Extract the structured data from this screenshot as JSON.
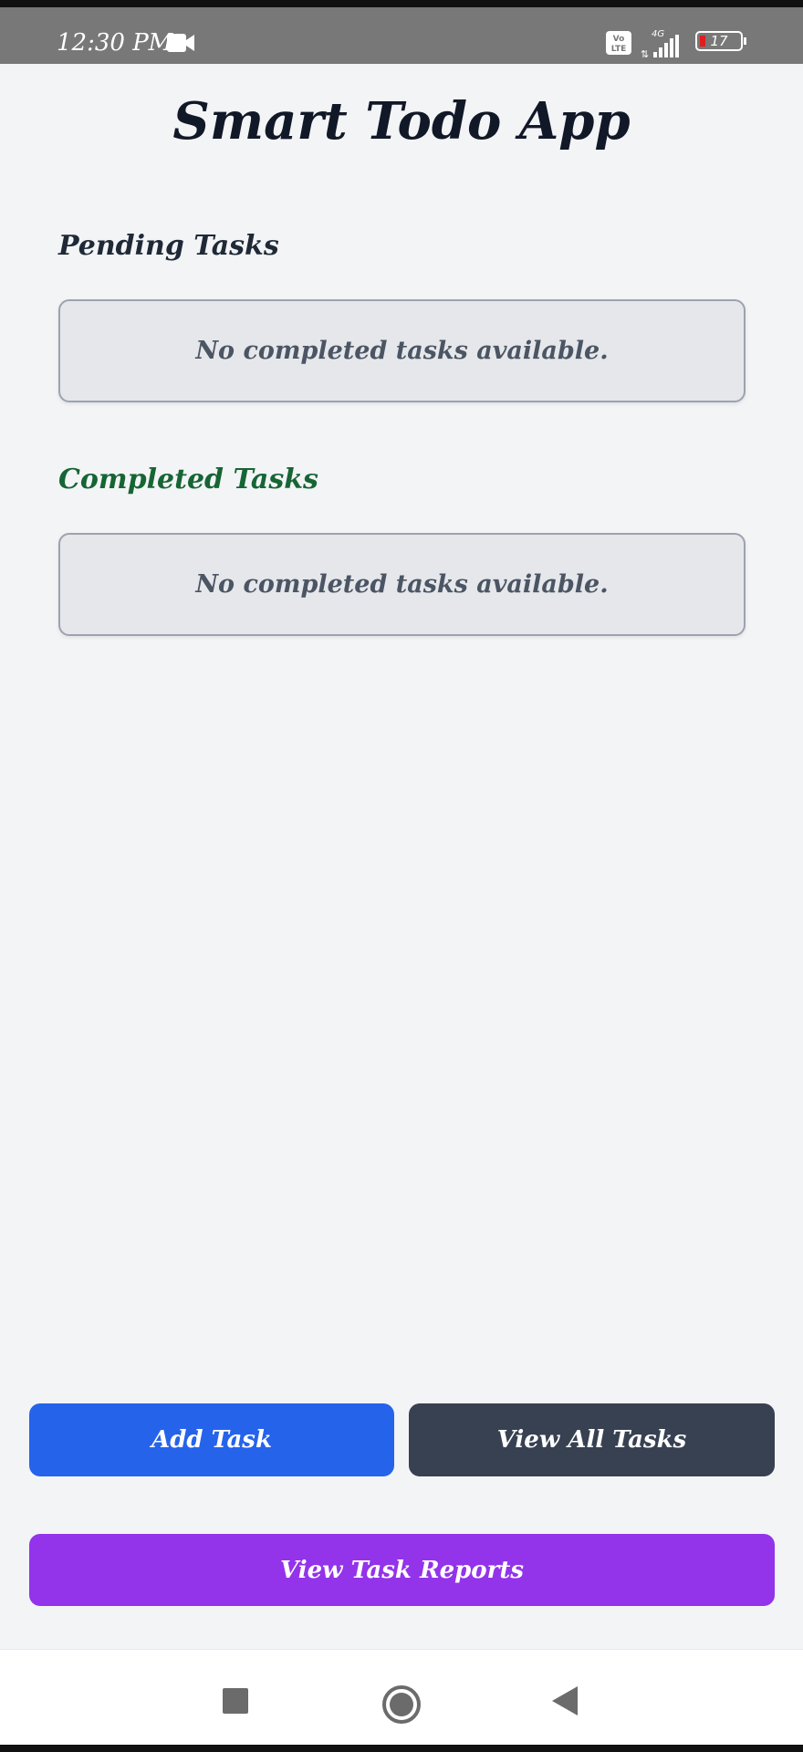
{
  "status_bar": {
    "time": "12:30 PM",
    "network": "4G",
    "battery": "17",
    "icons": [
      "video-camera-icon",
      "volte-icon",
      "signal-icon",
      "battery-icon"
    ]
  },
  "app": {
    "title": "Smart Todo App"
  },
  "pending": {
    "heading": "Pending Tasks",
    "empty_message": "No completed tasks available."
  },
  "completed": {
    "heading": "Completed Tasks",
    "empty_message": "No completed tasks available."
  },
  "actions": {
    "add_task": "Add Task",
    "view_all_tasks": "View All Tasks",
    "view_task_reports": "View Task Reports"
  },
  "colors": {
    "add_task": "#2563eb",
    "view_all_tasks": "#374151",
    "view_task_reports": "#9333ea",
    "completed_heading": "#166534"
  },
  "nav": {
    "icons": [
      "recents-icon",
      "home-icon",
      "back-icon"
    ]
  }
}
